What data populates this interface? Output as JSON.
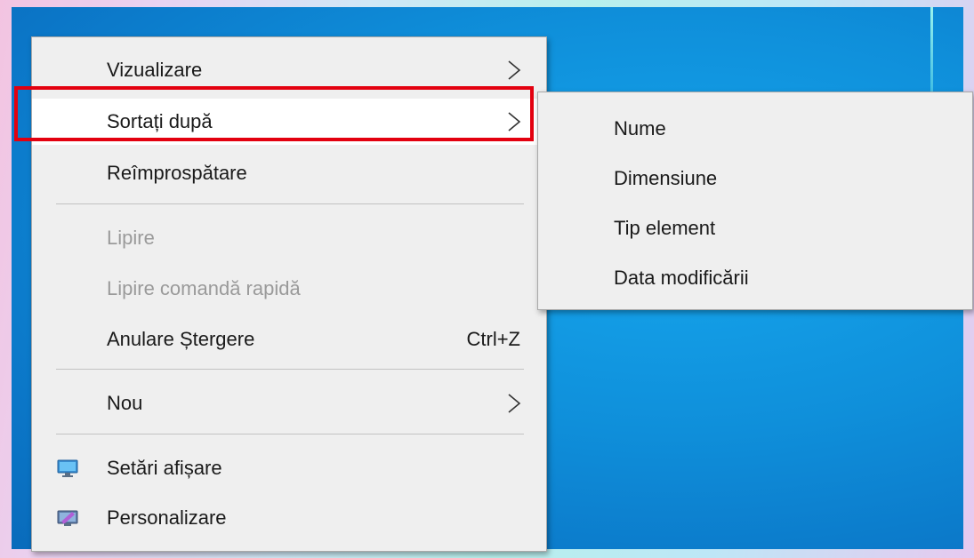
{
  "context_menu": {
    "items": [
      {
        "label": "Vizualizare",
        "submenu": true,
        "enabled": true
      },
      {
        "label": "Sortați după",
        "submenu": true,
        "enabled": true,
        "highlighted": true
      },
      {
        "label": "Reîmprospătare",
        "enabled": true
      },
      {
        "label": "Lipire",
        "enabled": false
      },
      {
        "label": "Lipire comandă rapidă",
        "enabled": false
      },
      {
        "label": "Anulare Ștergere",
        "shortcut": "Ctrl+Z",
        "enabled": true
      },
      {
        "label": "Nou",
        "submenu": true,
        "enabled": true
      },
      {
        "label": "Setări afișare",
        "icon": "display-settings-icon",
        "enabled": true
      },
      {
        "label": "Personalizare",
        "icon": "personalize-icon",
        "enabled": true
      }
    ]
  },
  "sort_submenu": {
    "items": [
      {
        "label": "Nume"
      },
      {
        "label": "Dimensiune"
      },
      {
        "label": "Tip element"
      },
      {
        "label": "Data modificării"
      }
    ]
  },
  "colors": {
    "menu_bg": "#efefef",
    "highlight_border": "#e3000f",
    "disabled_text": "#9a9a9a",
    "desktop": "#0f8fda"
  }
}
